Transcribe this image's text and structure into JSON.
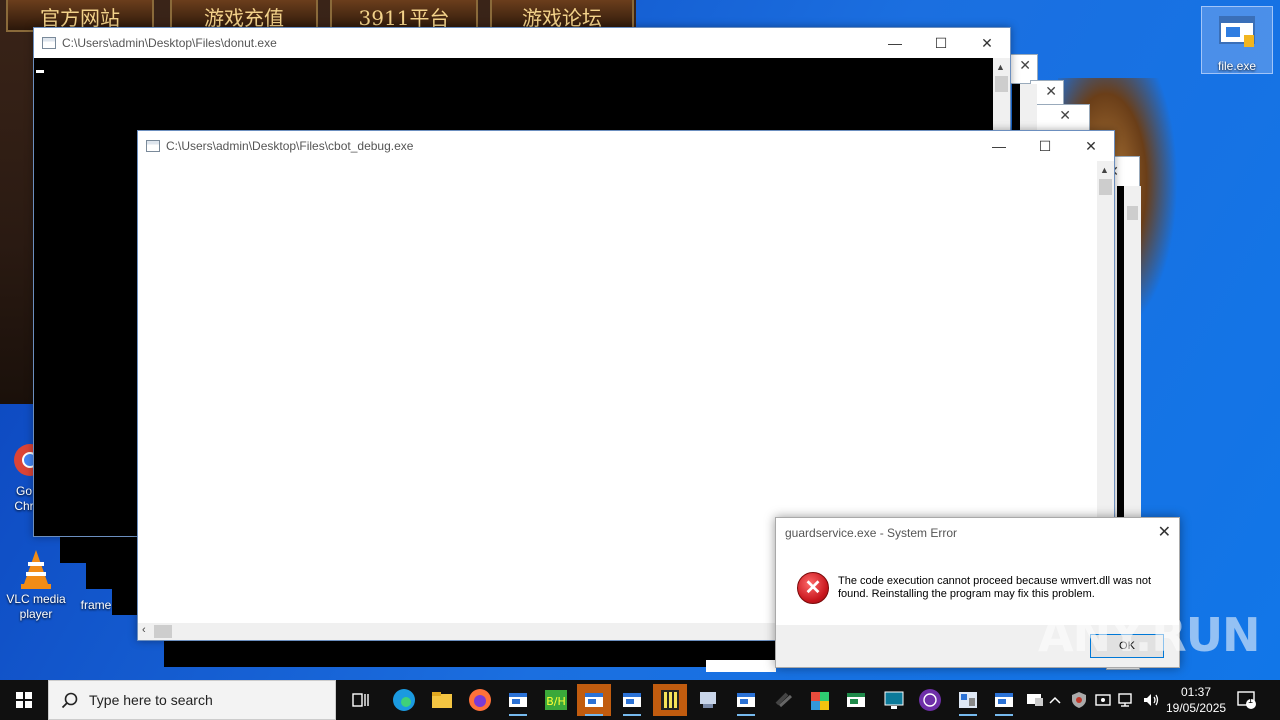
{
  "desktop": {
    "banner_tabs": [
      "官方网站",
      "游戏充值",
      "3911平台",
      "游戏论坛"
    ],
    "icons": {
      "chrome_label": "Go\nChr",
      "vlc_label": "VLC media player",
      "frame_label": "frame",
      "file_label": "file.exe"
    }
  },
  "windows": {
    "donut": {
      "title": "C:\\Users\\admin\\Desktop\\Files\\donut.exe"
    },
    "cbot": {
      "title": "C:\\Users\\admin\\Desktop\\Files\\cbot_debug.exe"
    },
    "controls": {
      "minimize": "—",
      "maximize": "☐",
      "close": "✕"
    }
  },
  "dialog": {
    "title": "guardservice.exe - System Error",
    "message": "The code execution cannot proceed because wmvert.dll was not found. Reinstalling the program may fix this problem.",
    "ok_label": "OK",
    "close": "✕"
  },
  "watermark": "ANY.RUN",
  "taskbar": {
    "search_placeholder": "Type here to search",
    "clock_time": "01:37",
    "clock_date": "19/05/2025",
    "notification_count": "1",
    "icons": [
      "task-view-icon",
      "edge-icon",
      "explorer-icon",
      "firefox-icon",
      "app-window-icon",
      "bh-icon",
      "app-window-icon",
      "app-window-icon",
      "archive-icon",
      "network-tool-icon",
      "app-window-icon",
      "link-icon",
      "office-icon",
      "app-window-icon",
      "monitor-icon",
      "tor-icon",
      "installer-icon",
      "app-window-icon"
    ]
  }
}
